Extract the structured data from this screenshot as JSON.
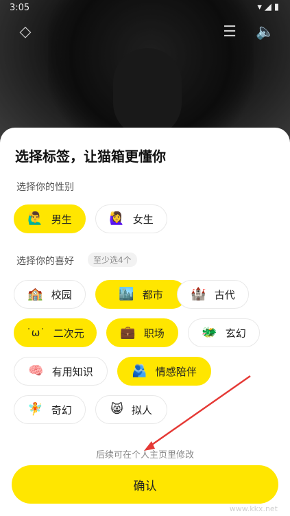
{
  "status_bar": {
    "time": "3:05"
  },
  "sheet": {
    "title": "选择标签，让猫箱更懂你",
    "gender": {
      "label": "选择你的性别",
      "options": [
        {
          "emoji": "🙋‍♂️",
          "label": "男生",
          "selected": true
        },
        {
          "emoji": "🙋‍♀️",
          "label": "女生",
          "selected": false
        }
      ]
    },
    "interests": {
      "label": "选择你的喜好",
      "hint": "至少选4个",
      "options": [
        {
          "emoji": "🏫",
          "label": "校园",
          "selected": false
        },
        {
          "emoji": "🏙️",
          "label": "都市",
          "selected": true
        },
        {
          "emoji": "🏰",
          "label": "古代",
          "selected": false
        },
        {
          "emoji": "˙ω˙",
          "label": "二次元",
          "selected": true
        },
        {
          "emoji": "💼",
          "label": "职场",
          "selected": true
        },
        {
          "emoji": "🐲",
          "label": "玄幻",
          "selected": false
        },
        {
          "emoji": "🧠",
          "label": "有用知识",
          "selected": false
        },
        {
          "emoji": "🫂",
          "label": "情感陪伴",
          "selected": true
        },
        {
          "emoji": "🧚",
          "label": "奇幻",
          "selected": false
        },
        {
          "emoji": "😸",
          "label": "拟人",
          "selected": false
        }
      ]
    },
    "footer_hint": "后续可在个人主页里修改",
    "confirm_label": "确认"
  },
  "watermark": "www.kkx.net",
  "colors": {
    "accent": "#ffe600",
    "annotation_arrow": "#e53935"
  }
}
